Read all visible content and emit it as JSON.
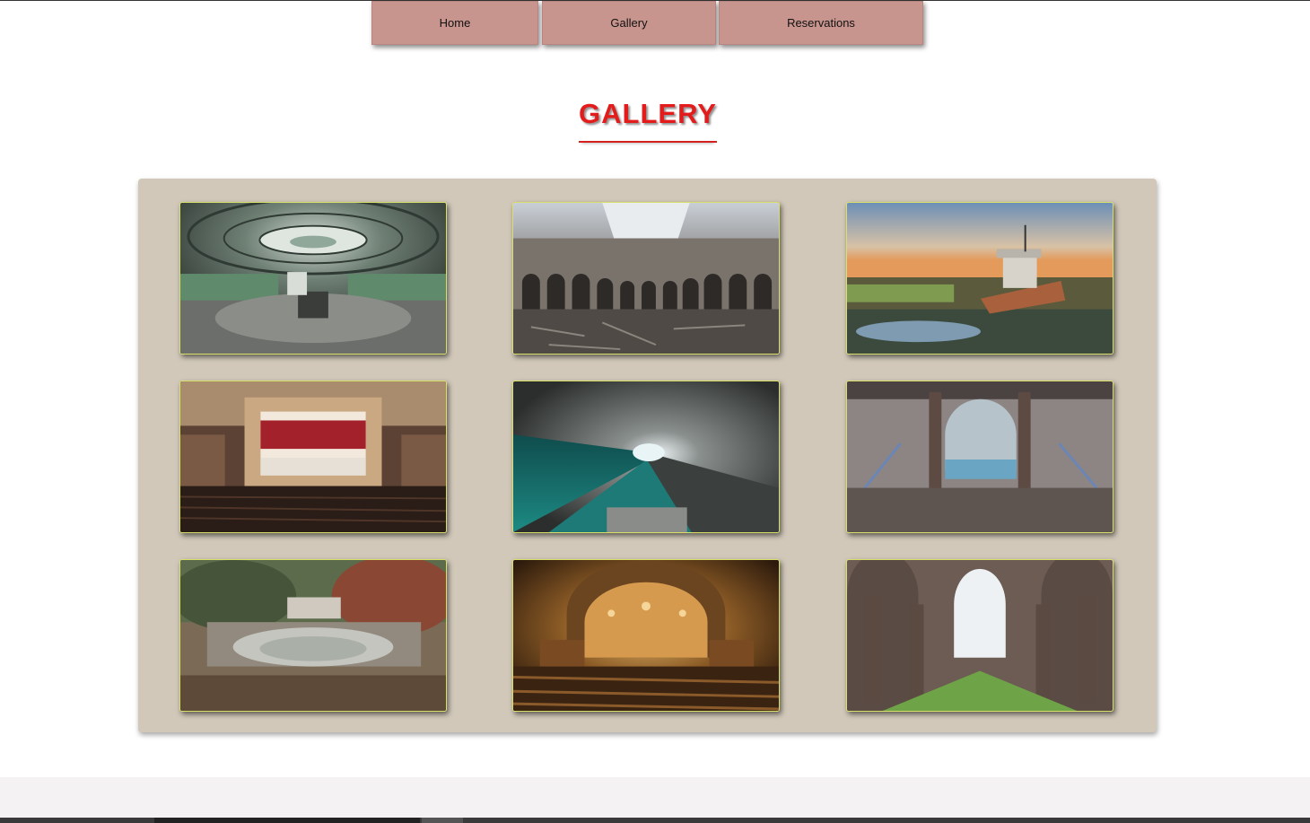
{
  "nav": {
    "items": [
      {
        "label": "Home"
      },
      {
        "label": "Gallery"
      },
      {
        "label": "Reservations"
      }
    ]
  },
  "page": {
    "title": "GALLERY"
  },
  "gallery": {
    "images": [
      {
        "subject": "abandoned power station control room with domed glass ceiling"
      },
      {
        "subject": "abandoned stock exchange hall with broken floor"
      },
      {
        "subject": "shipwreck boat stranded in marsh at sunset"
      },
      {
        "subject": "abandoned theater with red curtain and seats"
      },
      {
        "subject": "flooded underground submarine tunnel"
      },
      {
        "subject": "abandoned indoor swimming pool with stairs"
      },
      {
        "subject": "overgrown abandoned pond in forest"
      },
      {
        "subject": "abandoned church interior with organ and pews"
      },
      {
        "subject": "ruined gothic abbey with grass floor"
      }
    ]
  },
  "colors": {
    "nav_button": "#c8958e",
    "title": "#e41b1b",
    "panel": "#d1c8b9",
    "tile_border": "#d9e06a"
  }
}
